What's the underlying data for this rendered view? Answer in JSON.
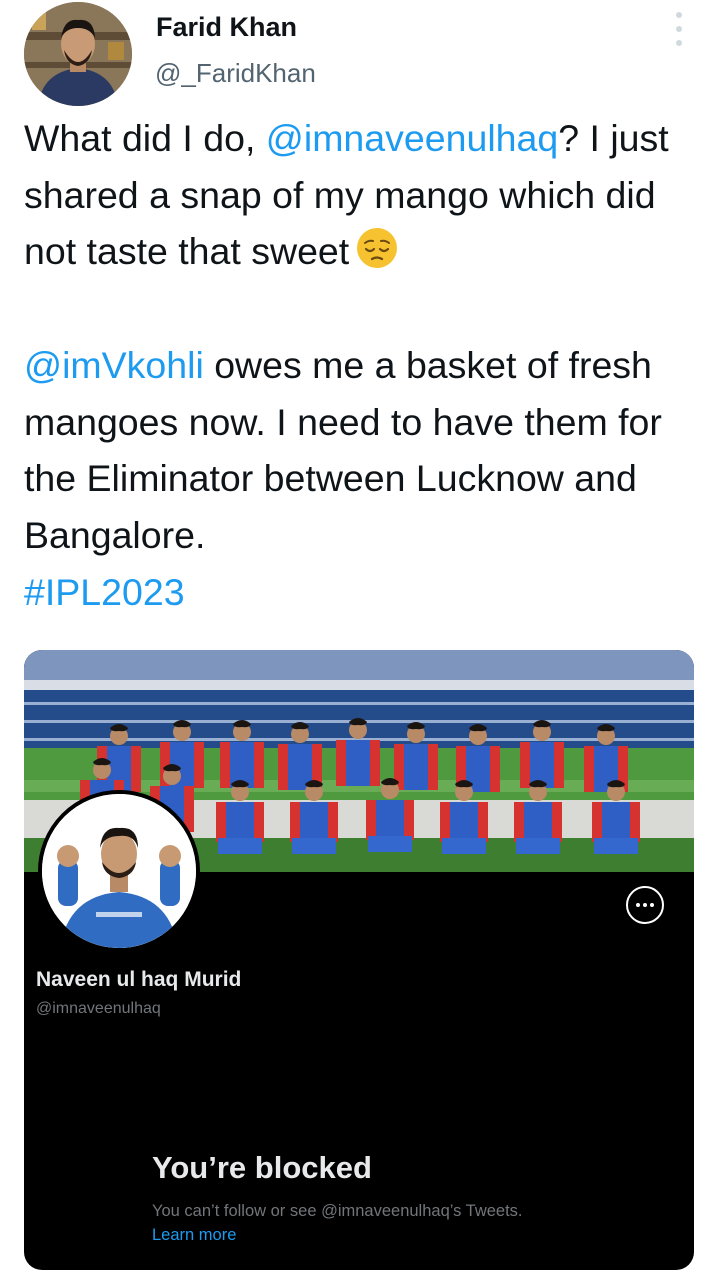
{
  "tweet": {
    "author_name": "Farid Khan",
    "author_handle": "@_FaridKhan",
    "para1": {
      "prefix": "What did I do, ",
      "mention": "@imnaveenulhaq",
      "rest": "? I just shared a snap of my mango which did not taste that sweet",
      "emoji": "pensive-face-emoji"
    },
    "para2": {
      "mention": "@imVkohli",
      "rest": " owes me a basket of fresh mangoes now. I need to have them for the Eliminator between Lucknow and Bangalore.",
      "hashtag": "#IPL2023"
    }
  },
  "profile_card": {
    "name": "Naveen ul haq Murid",
    "handle": "@imnaveenulhaq",
    "blocked_title": "You’re blocked",
    "blocked_desc": "You can’t follow or see @imnaveenulhaq’s Tweets.",
    "learn_more": "Learn more"
  },
  "colors": {
    "link": "#1d9bf0",
    "card_bg": "#000000",
    "handle_gray": "#536471",
    "jersey_blue": "#2f5fc4",
    "jersey_red": "#d6322f"
  },
  "icons": {
    "tweet_menu": "more-vertical-icon",
    "card_menu": "more-horizontal-icon"
  }
}
